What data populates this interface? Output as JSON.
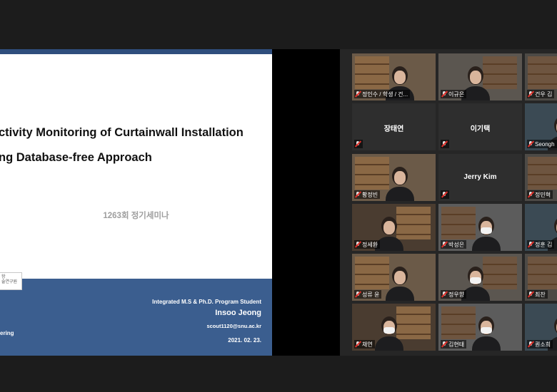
{
  "slide": {
    "title_line1": "ctivity Monitoring of Curtainwall Installation",
    "title_line2": "ng Database-free Approach",
    "seminar": "1263회 정기세미나",
    "logo_text": "항\n술연구원",
    "program": "Integrated M.S & Ph.D. Program Student",
    "presenter": "Insoo Jeong",
    "email": "scout1120@snu.ac.kr",
    "date": "2021. 02. 23.",
    "dept_fragment": "ering",
    "colors": {
      "footer": "#3b5e8f",
      "topbar": "#2f4e7d"
    }
  },
  "gallery": {
    "active_color": "#d6e24a",
    "muted_icon": "mic-muted-icon",
    "tiles": [
      {
        "name": "정인수 / 학생 / 건...",
        "video": true,
        "active": true
      },
      {
        "name": "이규은",
        "video": true
      },
      {
        "name": "건우 김",
        "video": true
      },
      {
        "name": "",
        "center_label": "장태연",
        "video": false
      },
      {
        "name": "",
        "center_label": "이기택",
        "video": false
      },
      {
        "name": "Seongh",
        "video": true
      },
      {
        "name": "황정빈",
        "video": true
      },
      {
        "name": "",
        "center_label": "Jerry Kim",
        "video": false
      },
      {
        "name": "정민혁",
        "video": true
      },
      {
        "name": "정세환",
        "video": true
      },
      {
        "name": "박성은",
        "video": true
      },
      {
        "name": "정훈 김",
        "video": true
      },
      {
        "name": "성류 윤",
        "video": true
      },
      {
        "name": "정우향",
        "video": true
      },
      {
        "name": "최찬",
        "video": true
      },
      {
        "name": "채연",
        "video": true
      },
      {
        "name": "김현태",
        "video": true
      },
      {
        "name": "퀀소희",
        "video": true
      }
    ]
  }
}
